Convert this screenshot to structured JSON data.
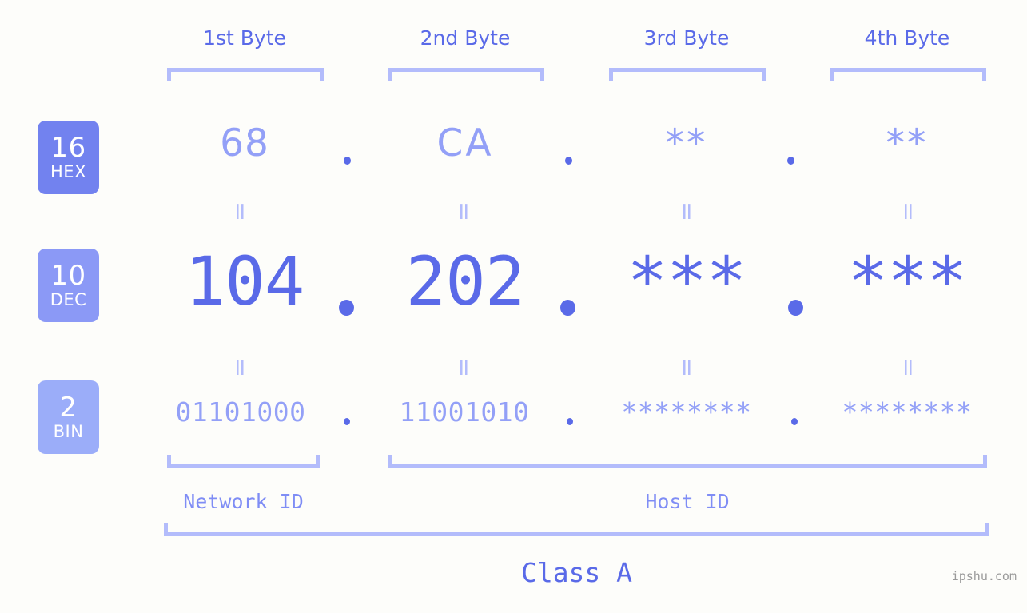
{
  "meta": {
    "watermark": "ipshu.com",
    "background": "#fdfdfa",
    "accent_dark": "#5a6ae8",
    "accent_mid": "#7f8df5",
    "accent_light": "#93a0f7",
    "bracket_color": "#b3bcfb"
  },
  "headers": [
    {
      "label": "1st Byte"
    },
    {
      "label": "2nd Byte"
    },
    {
      "label": "3rd Byte"
    },
    {
      "label": "4th Byte"
    }
  ],
  "bases": [
    {
      "number": "16",
      "name": "HEX",
      "color": "#7282ef"
    },
    {
      "number": "10",
      "name": "DEC",
      "color": "#8b99f6"
    },
    {
      "number": "2",
      "name": "BIN",
      "color": "#9badf9"
    }
  ],
  "rows": {
    "hex": {
      "base": "16",
      "values": [
        "68",
        "CA",
        "**",
        "**"
      ],
      "separator": "."
    },
    "dec": {
      "base": "10",
      "values": [
        "104",
        "202",
        "***",
        "***"
      ],
      "separator": "."
    },
    "bin": {
      "base": "2",
      "values": [
        "01101000",
        "11001010",
        "********",
        "********"
      ],
      "separator": "."
    }
  },
  "equals_mark": "=",
  "segments": {
    "network_id": "Network ID",
    "host_id": "Host ID",
    "class": "Class A"
  }
}
